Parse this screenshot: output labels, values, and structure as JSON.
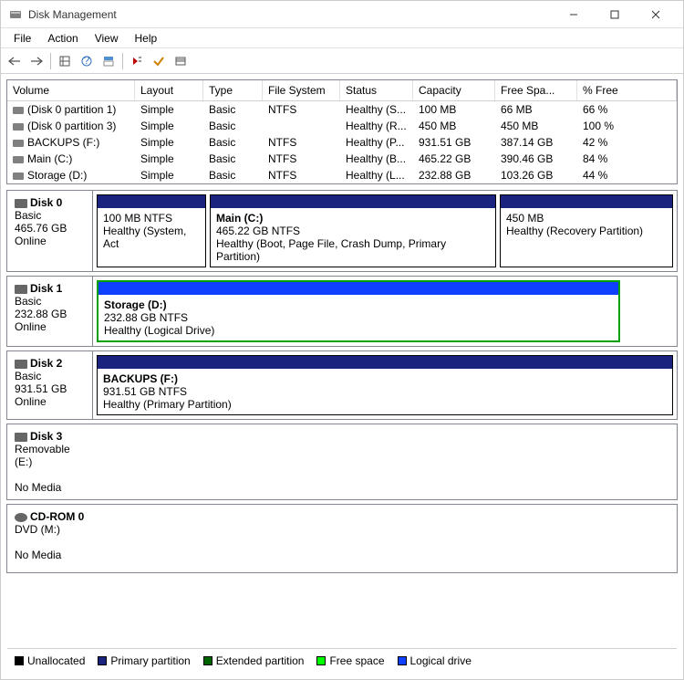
{
  "window": {
    "title": "Disk Management"
  },
  "menu": {
    "file": "File",
    "action": "Action",
    "view": "View",
    "help": "Help"
  },
  "columns": {
    "volume": "Volume",
    "layout": "Layout",
    "type": "Type",
    "fs": "File System",
    "status": "Status",
    "capacity": "Capacity",
    "free": "Free Spa...",
    "pct": "% Free"
  },
  "volumes": [
    {
      "name": "(Disk 0 partition 1)",
      "layout": "Simple",
      "type": "Basic",
      "fs": "NTFS",
      "status": "Healthy (S...",
      "capacity": "100 MB",
      "free": "66 MB",
      "pct": "66 %"
    },
    {
      "name": "(Disk 0 partition 3)",
      "layout": "Simple",
      "type": "Basic",
      "fs": "",
      "status": "Healthy (R...",
      "capacity": "450 MB",
      "free": "450 MB",
      "pct": "100 %"
    },
    {
      "name": "BACKUPS (F:)",
      "layout": "Simple",
      "type": "Basic",
      "fs": "NTFS",
      "status": "Healthy (P...",
      "capacity": "931.51 GB",
      "free": "387.14 GB",
      "pct": "42 %"
    },
    {
      "name": "Main (C:)",
      "layout": "Simple",
      "type": "Basic",
      "fs": "NTFS",
      "status": "Healthy (B...",
      "capacity": "465.22 GB",
      "free": "390.46 GB",
      "pct": "84 %"
    },
    {
      "name": "Storage (D:)",
      "layout": "Simple",
      "type": "Basic",
      "fs": "NTFS",
      "status": "Healthy (L...",
      "capacity": "232.88 GB",
      "free": "103.26 GB",
      "pct": "44 %"
    }
  ],
  "disks": {
    "d0": {
      "name": "Disk 0",
      "type": "Basic",
      "size": "465.76 GB",
      "status": "Online"
    },
    "d1": {
      "name": "Disk 1",
      "type": "Basic",
      "size": "232.88 GB",
      "status": "Online"
    },
    "d2": {
      "name": "Disk 2",
      "type": "Basic",
      "size": "931.51 GB",
      "status": "Online"
    },
    "d3": {
      "name": "Disk 3",
      "type": "Removable (E:)",
      "size": "",
      "status": "No Media"
    },
    "cd0": {
      "name": "CD-ROM 0",
      "type": "DVD (M:)",
      "size": "",
      "status": "No Media"
    }
  },
  "parts": {
    "d0p0": {
      "size": "100 MB NTFS",
      "status": "Healthy (System, Act"
    },
    "d0p1": {
      "name": "Main  (C:)",
      "size": "465.22 GB NTFS",
      "status": "Healthy (Boot, Page File, Crash Dump, Primary Partition)"
    },
    "d0p2": {
      "size": "450 MB",
      "status": "Healthy (Recovery Partition)"
    },
    "d1p0": {
      "name": "Storage  (D:)",
      "size": "232.88 GB NTFS",
      "status": "Healthy (Logical Drive)"
    },
    "d2p0": {
      "name": "BACKUPS  (F:)",
      "size": "931.51 GB NTFS",
      "status": "Healthy (Primary Partition)"
    }
  },
  "legend": {
    "unallocated": "Unallocated",
    "primary": "Primary partition",
    "extended": "Extended partition",
    "free": "Free space",
    "logical": "Logical drive"
  },
  "colors": {
    "stripe_primary": "#1a237e",
    "stripe_selected": "#1040ff",
    "selected_border": "#00a000",
    "unallocated": "#000000",
    "extended": "#006400",
    "free": "#00ff00",
    "logical": "#1040ff"
  }
}
